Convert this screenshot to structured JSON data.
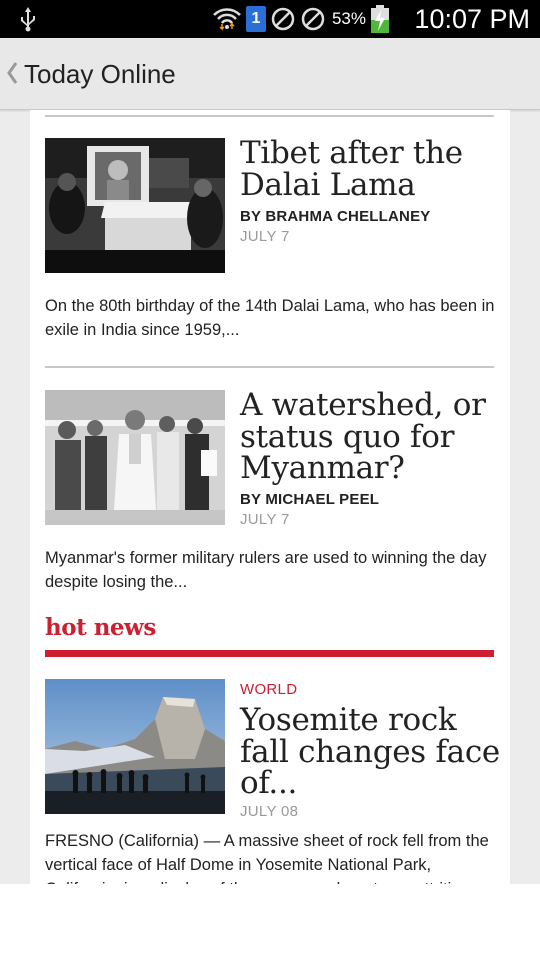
{
  "status_bar": {
    "time": "10:07 PM",
    "battery": "53%",
    "sim_badge": "1",
    "icons": [
      "usb-icon",
      "wifi-icon",
      "sim-icon",
      "blocked-icon",
      "blocked-icon",
      "battery-charging-icon"
    ]
  },
  "action_bar": {
    "title": "Today Online",
    "back_icon": "chevron-left-icon"
  },
  "articles": [
    {
      "headline": "Tibet after the Dalai Lama",
      "byline": "BY BRAHMA CHELLANEY",
      "date": "JULY 7",
      "summary": "On the 80th birthday of the 14th Dalai Lama, who has been in exile in India since 1959,..."
    },
    {
      "headline": "A watershed, or status quo for Myanmar?",
      "byline": "BY MICHAEL PEEL",
      "date": "JULY 7",
      "summary": "Myanmar's former military rulers are used to winning the day despite losing the..."
    }
  ],
  "hot_news": {
    "section_title": "hot news",
    "accent_color": "#cc1f2f",
    "article": {
      "category": "WORLD",
      "headline": "Yosemite rock fall changes face of...",
      "date": "JULY 08",
      "summary": "FRESNO (California) — A massive sheet of rock fell from the vertical face of Half Dome in Yosemite National Park, California, in a display of the awesome, long-term, attrition of..."
    }
  }
}
